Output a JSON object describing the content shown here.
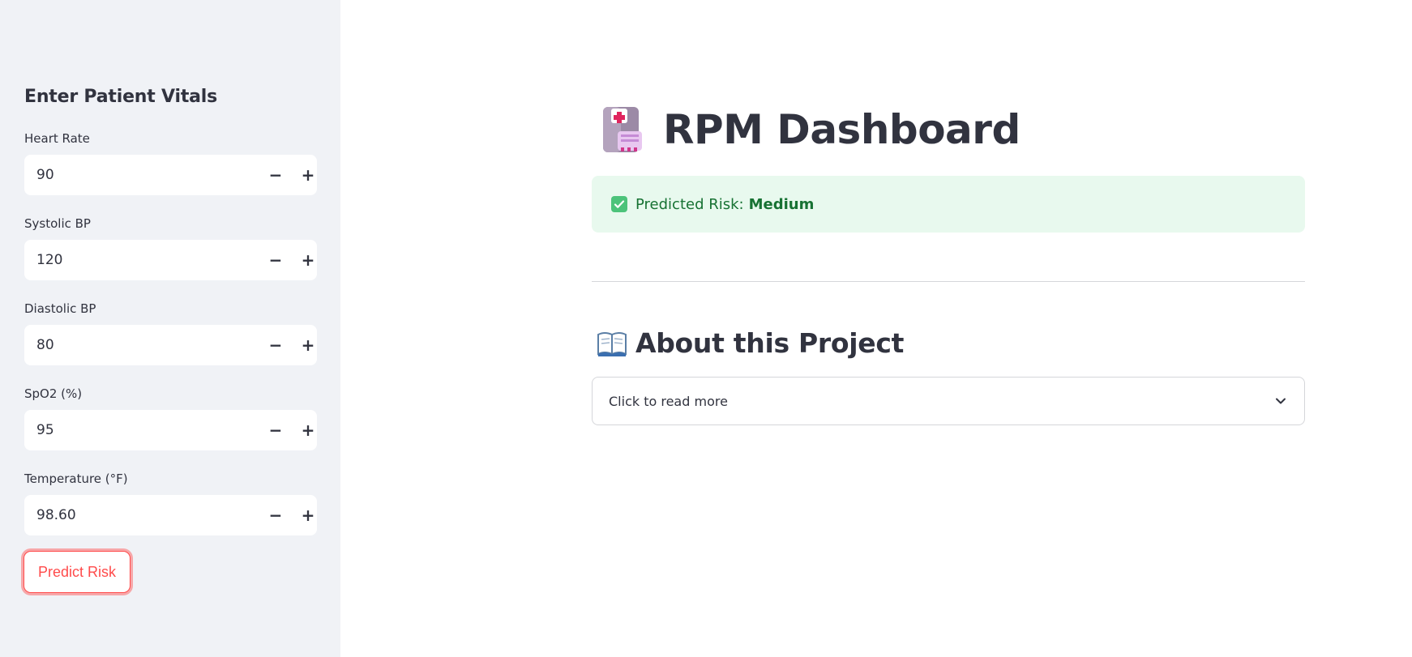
{
  "sidebar": {
    "title": "Enter Patient Vitals",
    "fields": [
      {
        "label": "Heart Rate",
        "value": "90"
      },
      {
        "label": "Systolic BP",
        "value": "120"
      },
      {
        "label": "Diastolic BP",
        "value": "80"
      },
      {
        "label": "SpO2 (%)",
        "value": "95"
      },
      {
        "label": "Temperature (°F)",
        "value": "98.60"
      }
    ],
    "stepper": {
      "minus": "−",
      "plus": "+"
    },
    "predict_button": "Predict Risk"
  },
  "main": {
    "title": "RPM Dashboard",
    "title_icon": "hospital-icon",
    "alert": {
      "icon": "check-icon",
      "label": "Predicted Risk:",
      "value": "Medium"
    },
    "section": {
      "icon": "open-book-icon",
      "title": "About this Project"
    },
    "expander": {
      "label": "Click to read more",
      "icon": "chevron-down-icon"
    }
  },
  "colors": {
    "sidebar_bg": "#f0f2f6",
    "accent": "#ff4b4b",
    "success_bg": "#e8f9ee",
    "success_text": "#177233",
    "text": "#31333f"
  }
}
